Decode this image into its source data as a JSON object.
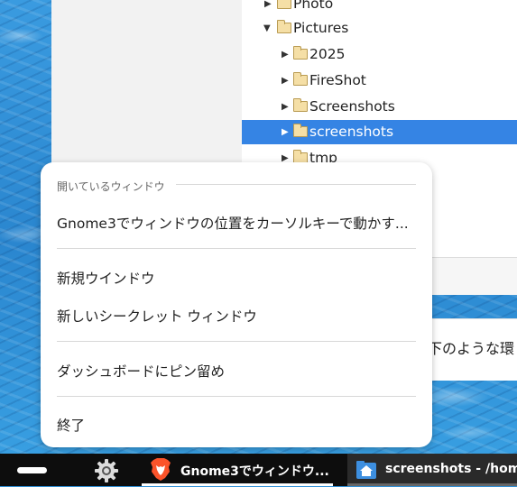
{
  "file_tree": {
    "items": [
      {
        "label": "Photo",
        "expanded": false
      },
      {
        "label": "Pictures",
        "expanded": true
      },
      {
        "label": "2025",
        "expanded": false
      },
      {
        "label": "FireShot",
        "expanded": false
      },
      {
        "label": "Screenshots",
        "expanded": false
      },
      {
        "label": "screenshots",
        "expanded": false,
        "selected": true
      },
      {
        "label": "tmp",
        "expanded": false
      }
    ]
  },
  "background_text": "下のような環",
  "context_menu": {
    "section_title": "開いているウィンドウ",
    "open_window": "Gnome3でウィンドウの位置をカーソルキーで動かす...",
    "new_window": "新規ウインドウ",
    "new_incognito": "新しいシークレット ウィンドウ",
    "pin_to_dash": "ダッシュボードにピン留め",
    "quit": "終了"
  },
  "taskbar": {
    "brave_task": "Gnome3でウィンドウ...",
    "files_task": "screenshots - /home/"
  },
  "colors": {
    "selection": "#3584e4",
    "brave_orange": "#fb542b",
    "files_blue": "#3d8fe0"
  },
  "icons": [
    "more-dots-icon",
    "folder-icon",
    "expand-arrow-icon",
    "gear-icon",
    "brave-lion-icon",
    "home-folder-icon"
  ]
}
